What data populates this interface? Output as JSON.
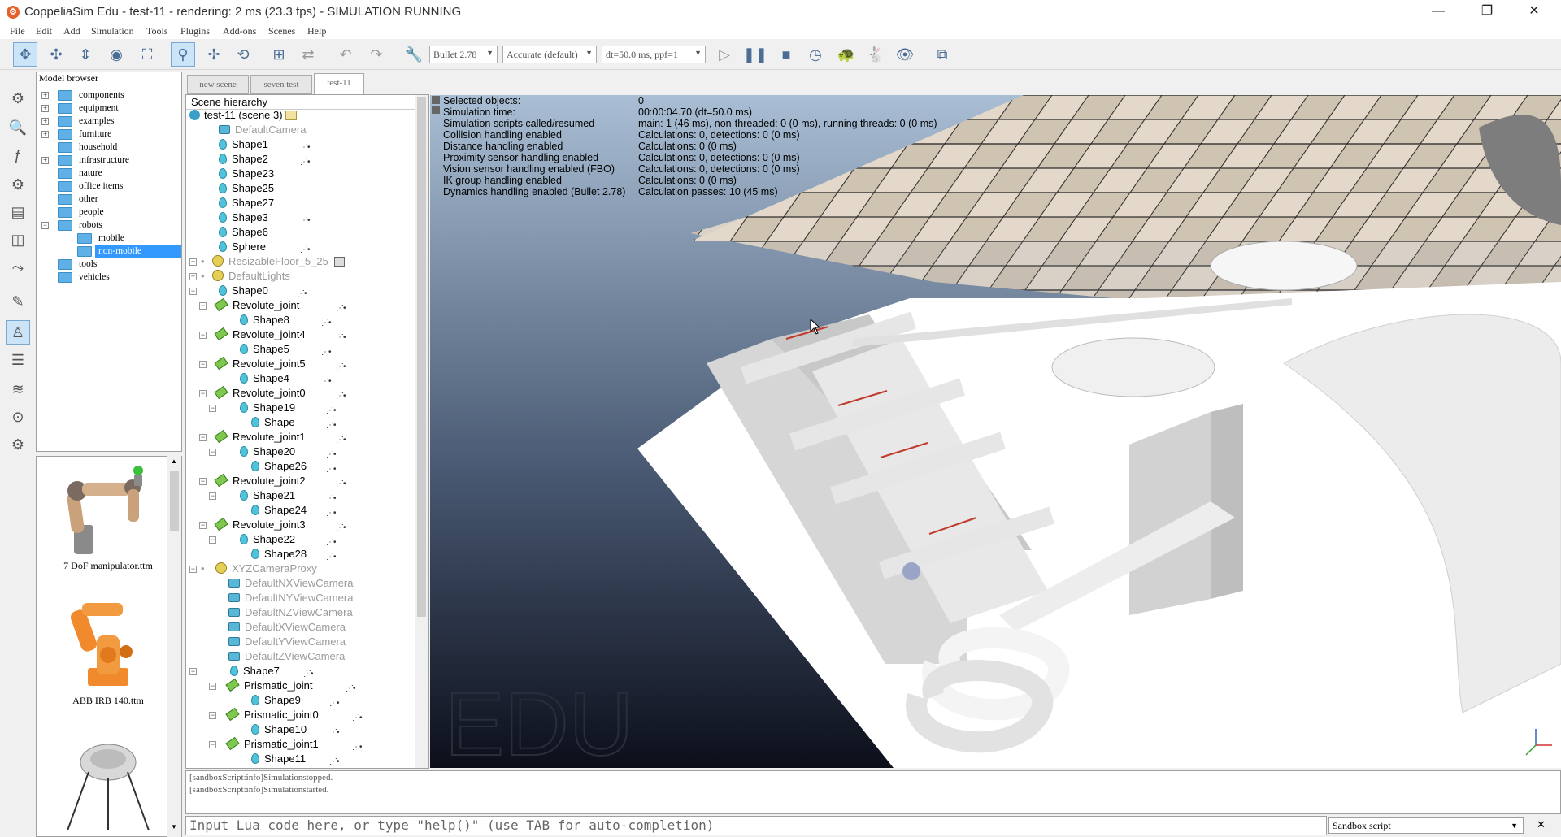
{
  "window": {
    "title": "CoppeliaSim Edu - test-11 - rendering: 2 ms (23.3 fps) - SIMULATION RUNNING",
    "minimize": "—",
    "maximize": "❐",
    "close": "✕"
  },
  "menu": [
    "File",
    "Edit",
    "Add",
    "Simulation",
    "Tools",
    "Plugins",
    "Add-ons",
    "Scenes",
    "Help"
  ],
  "toolbar": {
    "engine": "Bullet 2.78",
    "accuracy": "Accurate (default)",
    "timestep": "dt=50.0 ms, ppf=1"
  },
  "model_browser": {
    "title": "Model browser",
    "items": [
      "components",
      "equipment",
      "examples",
      "furniture",
      "household",
      "infrastructure",
      "nature",
      "office items",
      "other",
      "people",
      "robots",
      "mobile",
      "non-mobile",
      "tools",
      "vehicles"
    ]
  },
  "thumbnails": [
    "7 DoF manipulator.ttm",
    "ABB IRB 140.ttm"
  ],
  "tabs": [
    "new scene",
    "seven test",
    "test-11"
  ],
  "hierarchy": {
    "title": "Scene hierarchy",
    "close": "✕",
    "items": [
      "test-11 (scene 3)",
      "DefaultCamera",
      "Shape1",
      "Shape2",
      "Shape23",
      "Shape25",
      "Shape27",
      "Shape3",
      "Shape6",
      "Sphere",
      "ResizableFloor_5_25",
      "DefaultLights",
      "Shape0",
      "Revolute_joint",
      "Shape8",
      "Revolute_joint4",
      "Shape5",
      "Revolute_joint5",
      "Shape4",
      "Revolute_joint0",
      "Shape19",
      "Shape",
      "Revolute_joint1",
      "Shape20",
      "Shape26",
      "Revolute_joint2",
      "Shape21",
      "Shape24",
      "Revolute_joint3",
      "Shape22",
      "Shape28",
      "XYZCameraProxy",
      "DefaultNXViewCamera",
      "DefaultNYViewCamera",
      "DefaultNZViewCamera",
      "DefaultXViewCamera",
      "DefaultYViewCamera",
      "DefaultZViewCamera",
      "Shape7",
      "Prismatic_joint",
      "Shape9",
      "Prismatic_joint0",
      "Shape10",
      "Prismatic_joint1",
      "Shape11"
    ]
  },
  "info": {
    "labels": [
      "Selected objects:",
      "Simulation time:",
      "Simulation scripts called/resumed",
      "Collision handling enabled",
      "Distance handling enabled",
      "Proximity sensor handling enabled",
      "Vision sensor handling enabled (FBO)",
      "IK group handling enabled",
      "Dynamics handling enabled (Bullet 2.78)"
    ],
    "values": [
      "0",
      "00:00:04.70 (dt=50.0 ms)",
      "main: 1 (46 ms), non-threaded: 0 (0 ms), running threads: 0 (0 ms)",
      "Calculations: 0, detections: 0 (0 ms)",
      "Calculations: 0 (0 ms)",
      "Calculations: 0, detections: 0 (0 ms)",
      "Calculations: 0, detections: 0 (0 ms)",
      "Calculations: 0 (0 ms)",
      "Calculation passes: 10 (45 ms)"
    ]
  },
  "watermark": "EDU",
  "console": {
    "lines": [
      "[sandboxScript:info]Simulationstopped.",
      "[sandboxScript:info]Simulationstarted."
    ],
    "input_placeholder": "Input Lua code here, or type \"help()\" (use TAB for auto-completion)",
    "script_select": "Sandbox script",
    "close": "✕"
  },
  "colors": {
    "accent": "#3399ff",
    "sky_top": "#8fa8c4",
    "sky_bottom": "#0c0f1a",
    "floor_light": "#e8ddd0",
    "floor_dark": "#bcb09f"
  }
}
